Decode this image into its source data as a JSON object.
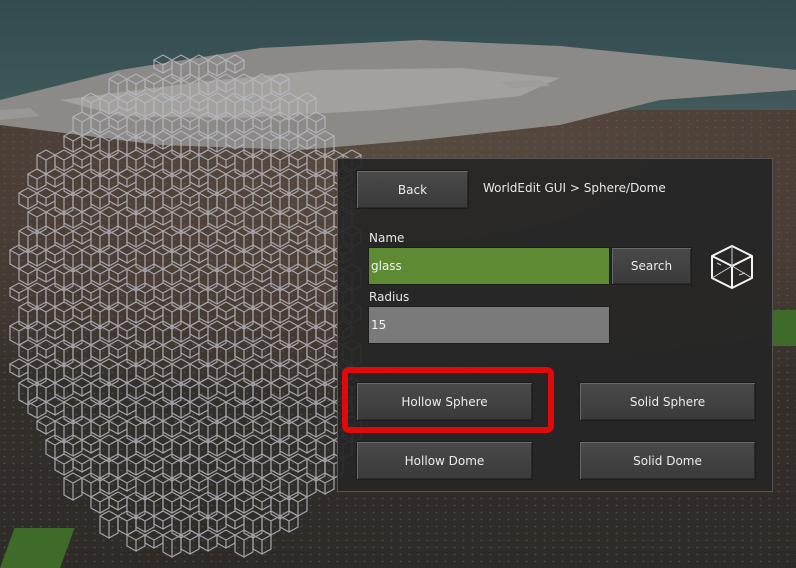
{
  "panel": {
    "back_label": "Back",
    "breadcrumb": "WorldEdit GUI > Sphere/Dome",
    "name_label": "Name",
    "name_value": "glass",
    "search_label": "Search",
    "radius_label": "Radius",
    "radius_value": "15",
    "block_icon": "glass-block-icon",
    "buttons": {
      "hollow_sphere": "Hollow Sphere",
      "solid_sphere": "Solid Sphere",
      "hollow_dome": "Hollow Dome",
      "solid_dome": "Solid Dome"
    }
  },
  "colors": {
    "highlight": "#e00a0a",
    "name_field": "#5e8a33",
    "radius_field": "#7a7a7a"
  }
}
